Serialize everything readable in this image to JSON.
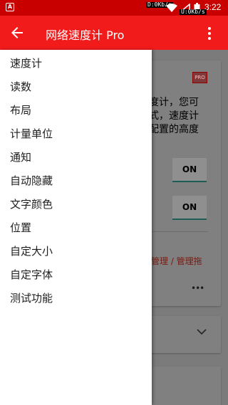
{
  "status_bar": {
    "badge": "A",
    "down_speed": "D:0Kb/s",
    "up_speed": "U:0Kb/s",
    "time": "3:22",
    "icons": [
      "wifi-icon",
      "signal-icon",
      "battery-icon"
    ]
  },
  "app_bar": {
    "title": "网络速度计 Pro",
    "back_icon": "arrow-back-icon",
    "menu_icon": "more-vert-icon"
  },
  "drawer": {
    "items": [
      {
        "label": "速度计"
      },
      {
        "label": "读数"
      },
      {
        "label": "布局"
      },
      {
        "label": "计量单位"
      },
      {
        "label": "通知"
      },
      {
        "label": "自动隐藏"
      },
      {
        "label": "文字颜色"
      },
      {
        "label": "位置"
      },
      {
        "label": "自定大小"
      },
      {
        "label": "自定字体"
      },
      {
        "label": "测试功能"
      }
    ]
  },
  "background": {
    "pro_badge": "PRO",
    "description_lines": [
      "度计，您可",
      "式，速度计",
      "配置的高度"
    ],
    "toggle1": "ON",
    "toggle2": "ON",
    "manage_link": "管理 / 管理拖",
    "overflow_dots": "•••"
  },
  "colors": {
    "app_bar": "#f21b1b",
    "status_bar": "#c80000",
    "drawer_bg": "#ffffff",
    "scrim": "#7b7b7b"
  }
}
